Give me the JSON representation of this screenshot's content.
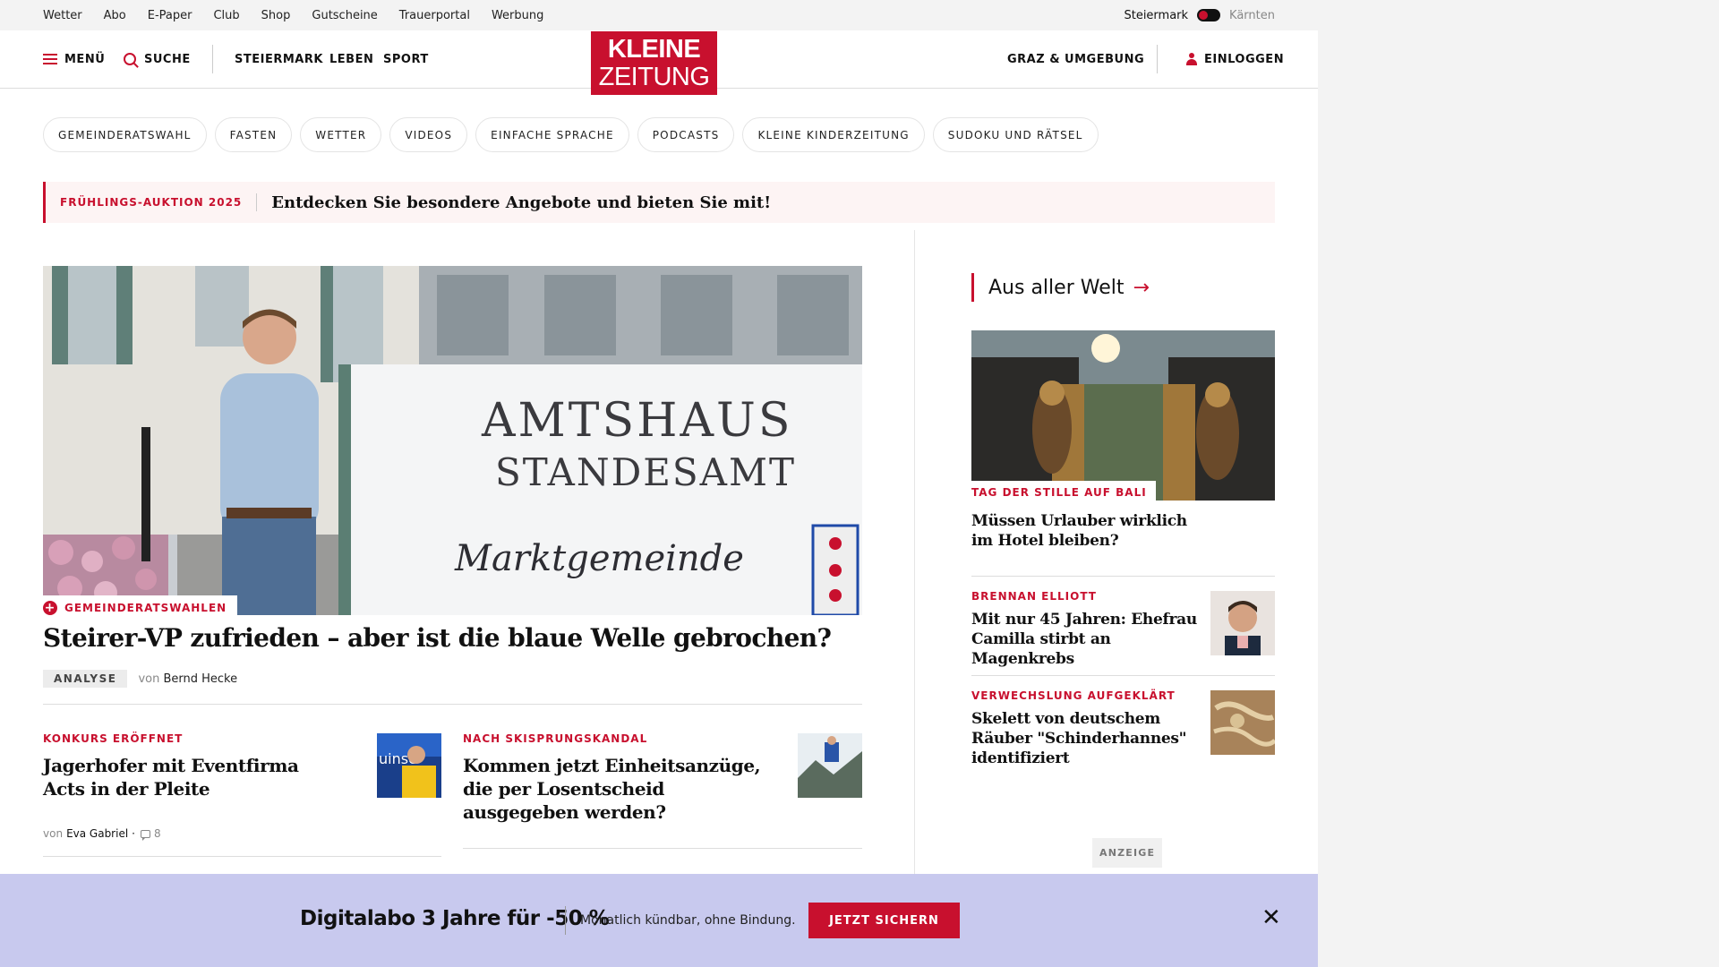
{
  "utility_bar": {
    "links": [
      "Wetter",
      "Abo",
      "E-Paper",
      "Club",
      "Shop",
      "Gutscheine",
      "Trauerportal",
      "Werbung"
    ],
    "region_active": "Steiermark",
    "region_inactive": "Kärnten"
  },
  "header": {
    "menu_label": "MENÜ",
    "search_label": "SUCHE",
    "nav": [
      "STEIERMARK",
      "LEBEN",
      "SPORT"
    ],
    "logo_line1": "KLEINE",
    "logo_line2": "ZEITUNG",
    "local_label": "GRAZ & UMGEBUNG",
    "login_label": "EINLOGGEN"
  },
  "topics": [
    "GEMEINDERATSWAHL",
    "FASTEN",
    "WETTER",
    "VIDEOS",
    "EINFACHE SPRACHE",
    "PODCASTS",
    "KLEINE KINDERZEITUNG",
    "SUDOKU UND RÄTSEL"
  ],
  "promo": {
    "kicker": "FRÜHLINGS-AUKTION 2025",
    "text": "Entdecken Sie besondere Angebote und bieten Sie mit!"
  },
  "hero": {
    "image_sign_line1": "AMTSHAUS",
    "image_sign_line2": "STANDESAMT",
    "image_sign_line3": "Marktgemeinde",
    "kicker": "GEMEINDERATSWAHLEN",
    "title": "Steirer-VP zufrieden – aber ist die blaue Welle gebrochen?",
    "badge": "ANALYSE",
    "by": "von",
    "author": "Bernd Hecke"
  },
  "teasers": [
    {
      "kicker": "KONKURS ERÖFFNET",
      "title_line1": "Jagerhofer mit Eventfirma",
      "title_line2": "Acts in der Pleite",
      "by": "von",
      "author": "Eva Gabriel",
      "comments": "8"
    },
    {
      "kicker": "NACH SKISPRUNGSKANDAL",
      "title_line1": "Kommen jetzt Einheitsanzüge,",
      "title_line2": "die per Losentscheid",
      "title_line3": "ausgegeben werden?"
    }
  ],
  "sidebar": {
    "heading": "Aus aller Welt",
    "items": [
      {
        "kicker": "TAG DER STILLE AUF BALI",
        "title_line1": "Müssen Urlauber wirklich",
        "title_line2": "im Hotel bleiben?"
      },
      {
        "kicker": "BRENNAN ELLIOTT",
        "title_line1": "Mit nur 45 Jahren: Ehefrau",
        "title_line2": "Camilla stirbt an Magenkrebs"
      },
      {
        "kicker": "VERWECHSLUNG AUFGEKLÄRT",
        "title_line1": "Skelett von deutschem",
        "title_line2": "Räuber \"Schinderhannes\"",
        "title_line3": "identifiziert"
      }
    ],
    "ad_label": "ANZEIGE"
  },
  "offer": {
    "title": "Digitalabo 3 Jahre für -50 %",
    "subtitle": "Monatlich kündbar, ohne Bindung.",
    "button": "JETZT SICHERN"
  },
  "colors": {
    "brand_red": "#c8102e",
    "overlay_bg": "#c8c9ee",
    "promo_bg": "#fdf4f4"
  }
}
